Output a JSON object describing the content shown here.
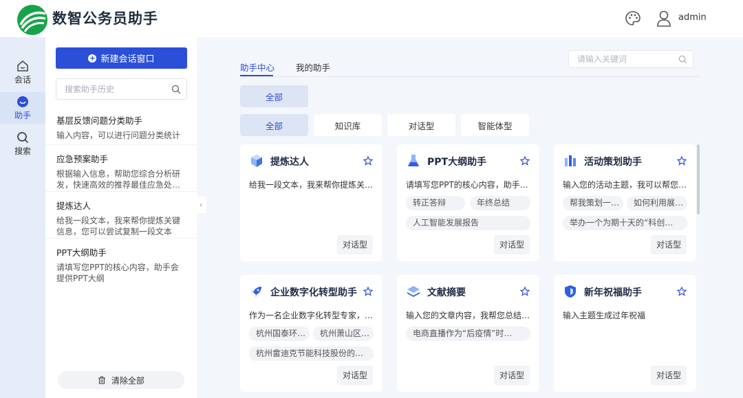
{
  "header": {
    "brand": "数智公务员助手",
    "username": "admin"
  },
  "rail": [
    {
      "label": "会话",
      "icon": "home-icon"
    },
    {
      "label": "助手",
      "icon": "assistant-icon"
    },
    {
      "label": "搜索",
      "icon": "search-icon"
    }
  ],
  "history": {
    "new_button": "新建会话窗口",
    "search_placeholder": "搜索助手历史",
    "items": [
      {
        "title": "基层反馈问题分类助手",
        "desc": "输入内容，可以进行问题分类统计"
      },
      {
        "title": "应急预案助手",
        "desc": "根据输入信息，帮助您综合分析研发，快速高效的推荐最佳应急处…"
      },
      {
        "title": "提炼达人",
        "desc": "给我一段文本，我来帮你提炼关键信息，您可以尝试复制一段文本"
      },
      {
        "title": "PPT大纲助手",
        "desc": "请填写您PPT的核心内容，助手会提供PPT大纲"
      }
    ],
    "clear_button": "清除全部"
  },
  "main": {
    "tabs": [
      "助手中心",
      "我的助手"
    ],
    "search_placeholder": "请输入关键词",
    "filter_row1": [
      "全部"
    ],
    "filter_row2": [
      "全部",
      "知识库",
      "对话型",
      "智能体型"
    ],
    "cards": [
      {
        "name": "提炼达人",
        "desc": "给我一段文本，我来帮你提炼关…",
        "chips": [],
        "type": "对话型",
        "icon": "cube-icon"
      },
      {
        "name": "PPT大纲助手",
        "desc": "请填写您PPT的核心内容，助手…",
        "chips": [
          "转正答辩",
          "年终总结",
          "人工智能发展报告"
        ],
        "type": "对话型",
        "icon": "flask-icon"
      },
      {
        "name": "活动策划助手",
        "desc": "输入您的活动主题，我可以帮您…",
        "chips": [
          "帮我策划一…",
          "如何利用展…",
          "举办一个为期十天的“科创…"
        ],
        "type": "对话型",
        "icon": "building-icon"
      },
      {
        "name": "企业数字化转型助手",
        "desc": "作为一名企业数字化转型专家，…",
        "chips": [
          "杭州国泰环…",
          "杭州萧山区…",
          "杭州畲迪克节能科技股份的…"
        ],
        "type": "对话型",
        "icon": "rocket-icon"
      },
      {
        "name": "文献摘要",
        "desc": "输入您的文章内容，我帮您总结…",
        "chips": [
          "电商直播作为“后疫情”时…"
        ],
        "type": "对话型",
        "icon": "layers-icon"
      },
      {
        "name": "新年祝福助手",
        "desc": "输入主题生成过年祝福",
        "chips": [],
        "type": "对话型",
        "icon": "shield-icon"
      }
    ]
  }
}
